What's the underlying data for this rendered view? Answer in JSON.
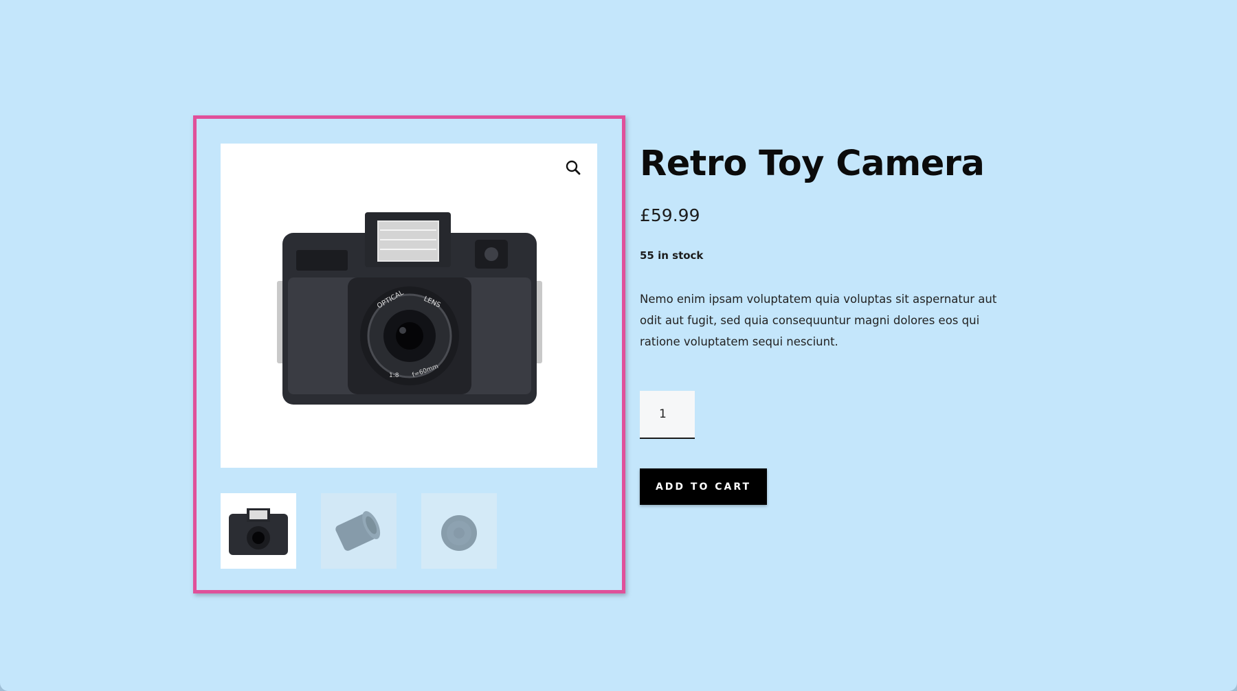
{
  "product": {
    "title": "Retro Toy Camera",
    "price": "£59.99",
    "stock": "55 in stock",
    "description": "Nemo enim ipsam voluptatem quia voluptas sit aspernatur aut odit aut fugit, sed quia consequuntur magni dolores eos qui ratione voluptatem sequi nesciunt."
  },
  "cart": {
    "quantity": "1",
    "add_to_cart_label": "ADD TO CART"
  },
  "gallery": {
    "zoom_icon": "magnifier-icon",
    "main_image": "retro-camera-image",
    "thumbnails": [
      {
        "name": "retro-camera-thumb",
        "active": true
      },
      {
        "name": "lens-thumb",
        "active": false
      },
      {
        "name": "lens-cap-thumb",
        "active": false
      }
    ]
  },
  "colors": {
    "background": "#c4e6fb",
    "frame_border": "#e0509a",
    "button": "#000000"
  }
}
